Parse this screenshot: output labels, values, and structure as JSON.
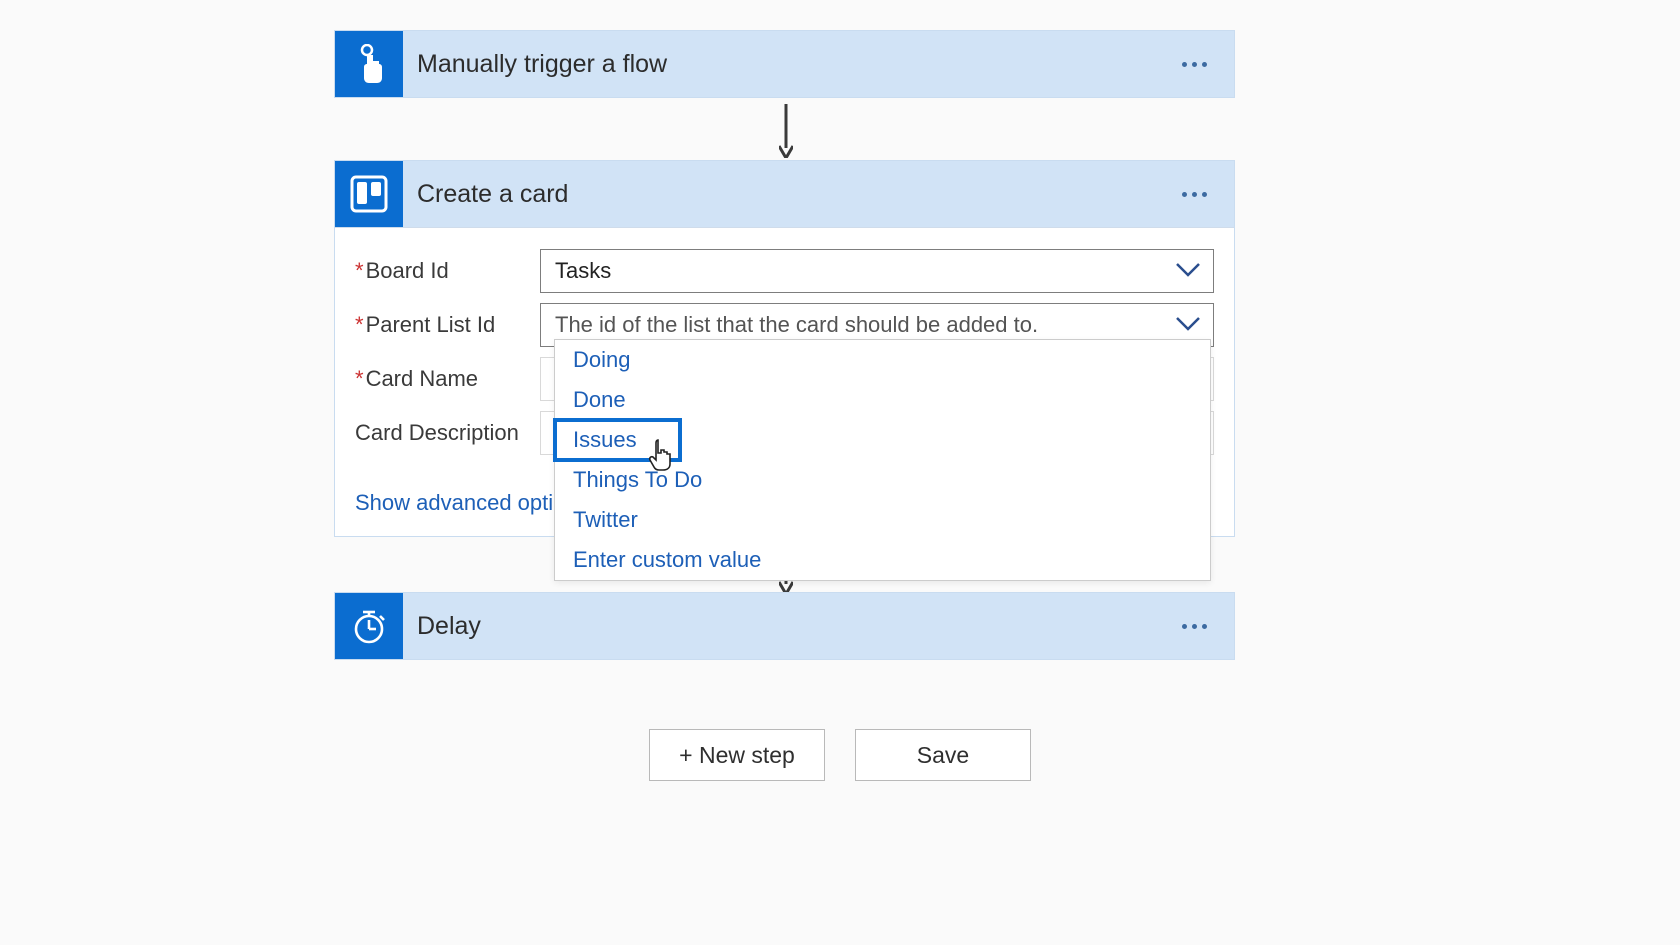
{
  "trigger": {
    "title": "Manually trigger a flow"
  },
  "action": {
    "title": "Create a card",
    "fields": {
      "boardId": {
        "label": "Board Id",
        "value": "Tasks"
      },
      "parentListId": {
        "label": "Parent List Id",
        "placeholder": "The id of the list that the card should be added to."
      },
      "cardName": {
        "label": "Card Name"
      },
      "cardDescription": {
        "label": "Card Description"
      }
    },
    "showAdvanced": "Show advanced options"
  },
  "dropdown": {
    "options": [
      "Doing",
      "Done",
      "Issues",
      "Things To Do",
      "Twitter",
      "Enter custom value"
    ],
    "highlightedIndex": 2
  },
  "delay": {
    "title": "Delay"
  },
  "buttons": {
    "newStep": "+ New step",
    "save": "Save"
  }
}
